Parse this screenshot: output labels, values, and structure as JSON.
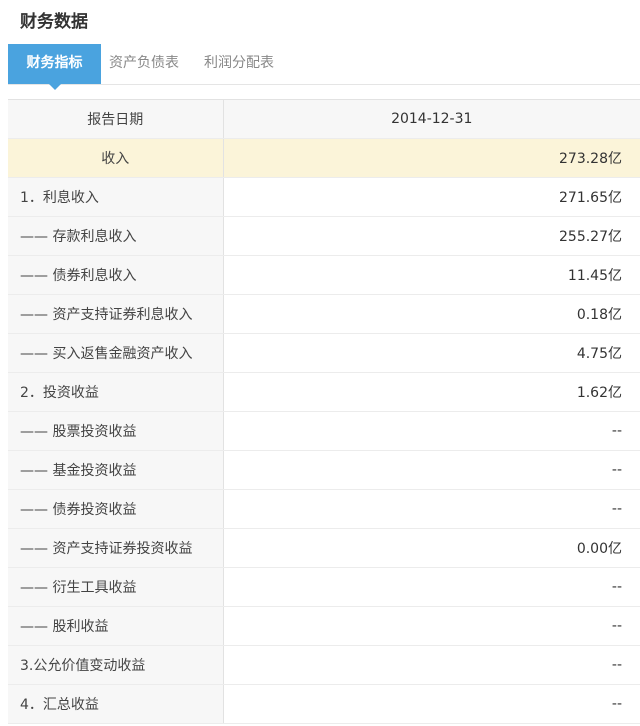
{
  "page": {
    "title": "财务数据"
  },
  "tabs": [
    {
      "label": "财务指标",
      "active": true
    },
    {
      "label": "资产负债表",
      "active": false
    },
    {
      "label": "利润分配表",
      "active": false
    }
  ],
  "table": {
    "header": {
      "label": "报告日期",
      "value": "2014-12-31"
    },
    "rows": [
      {
        "label": "收入",
        "value": "273.28亿"
      },
      {
        "label": "1．利息收入",
        "value": "271.65亿"
      },
      {
        "label": "—— 存款利息收入",
        "value": "255.27亿"
      },
      {
        "label": "—— 债券利息收入",
        "value": "11.45亿"
      },
      {
        "label": "—— 资产支持证券利息收入",
        "value": "0.18亿"
      },
      {
        "label": "—— 买入返售金融资产收入",
        "value": "4.75亿"
      },
      {
        "label": "2．投资收益",
        "value": "1.62亿"
      },
      {
        "label": "—— 股票投资收益",
        "value": "--"
      },
      {
        "label": "—— 基金投资收益",
        "value": "--"
      },
      {
        "label": "—— 债券投资收益",
        "value": "--"
      },
      {
        "label": "—— 资产支持证券投资收益",
        "value": "0.00亿"
      },
      {
        "label": "—— 衍生工具收益",
        "value": "--"
      },
      {
        "label": "—— 股利收益",
        "value": "--"
      },
      {
        "label": "3.公允价值变动收益",
        "value": "--"
      },
      {
        "label": "4．汇总收益",
        "value": "--"
      }
    ]
  }
}
